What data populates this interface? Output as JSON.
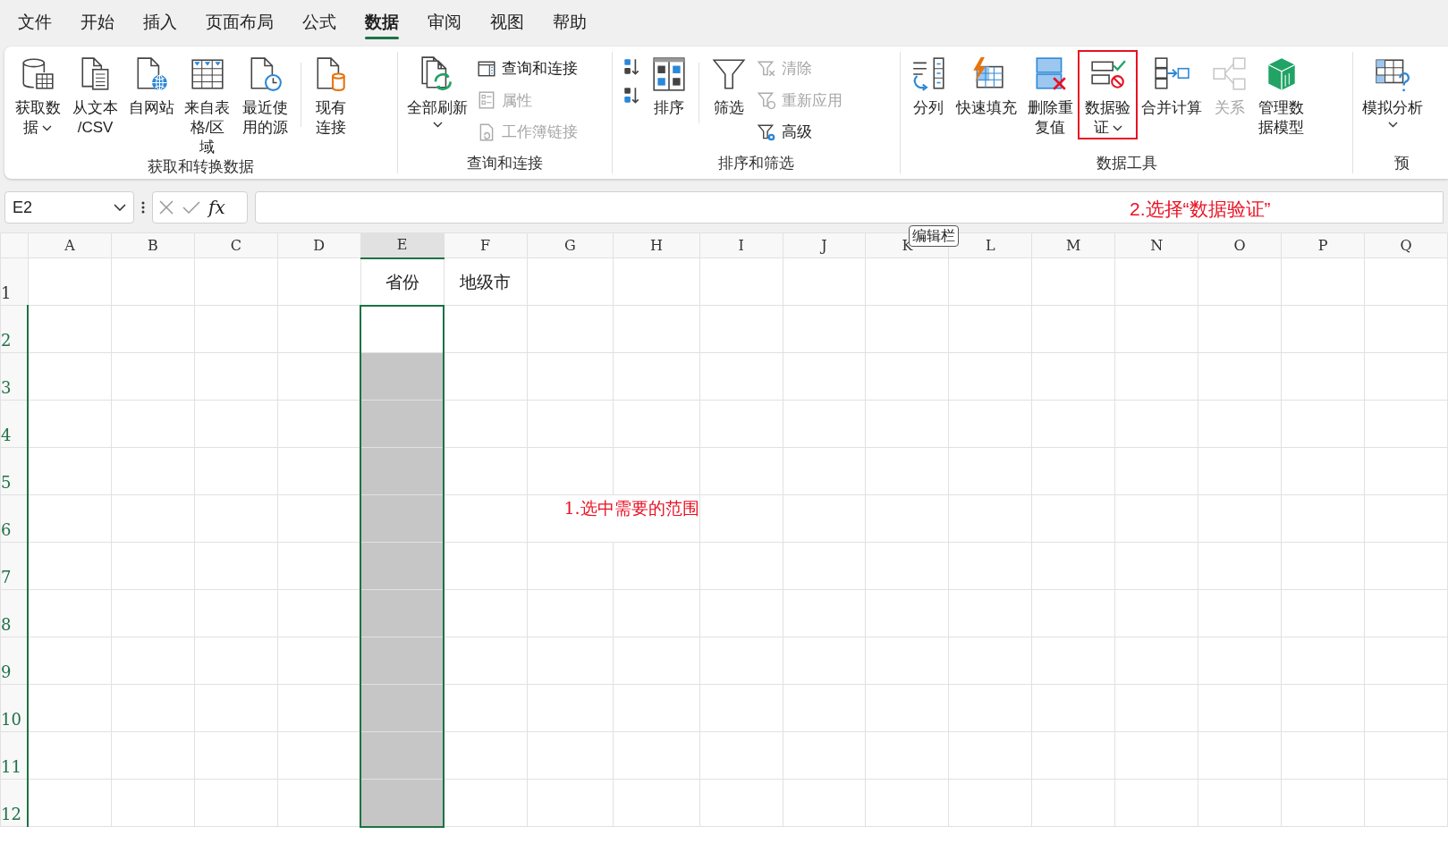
{
  "menu_tabs": [
    {
      "label": "文件",
      "selected": false
    },
    {
      "label": "开始",
      "selected": false
    },
    {
      "label": "插入",
      "selected": false
    },
    {
      "label": "页面布局",
      "selected": false
    },
    {
      "label": "公式",
      "selected": false
    },
    {
      "label": "数据",
      "selected": true
    },
    {
      "label": "审阅",
      "selected": false
    },
    {
      "label": "视图",
      "selected": false
    },
    {
      "label": "帮助",
      "selected": false
    }
  ],
  "ribbon_groups": [
    {
      "label": "获取和转换数据",
      "items": [
        {
          "kind": "large",
          "label": "获取数据",
          "dropdown": true,
          "disabled": false,
          "highlighted": false
        },
        {
          "kind": "large",
          "label": "从文本/CSV",
          "dropdown": false,
          "disabled": false,
          "highlighted": false
        },
        {
          "kind": "large",
          "label": "自网站",
          "dropdown": false,
          "disabled": false,
          "highlighted": false
        },
        {
          "kind": "large",
          "label": "来自表格/区域",
          "dropdown": false,
          "disabled": false,
          "highlighted": false
        },
        {
          "kind": "large",
          "label": "最近使用的源",
          "dropdown": false,
          "disabled": false,
          "highlighted": false
        },
        {
          "kind": "separator"
        },
        {
          "kind": "large",
          "label": "现有连接",
          "dropdown": false,
          "disabled": false,
          "highlighted": false
        }
      ]
    },
    {
      "label": "查询和连接",
      "items": [
        {
          "kind": "large",
          "label": "全部刷新",
          "dropdown": true,
          "disabled": false,
          "highlighted": false
        },
        {
          "kind": "stack",
          "items": [
            {
              "label": "查询和连接",
              "disabled": false
            },
            {
              "label": "属性",
              "disabled": true
            },
            {
              "label": "工作簿链接",
              "disabled": true
            }
          ]
        }
      ]
    },
    {
      "label": "排序和筛选",
      "items": [
        {
          "kind": "stack",
          "items": [
            {
              "disabled": false
            },
            {
              "disabled": false
            }
          ]
        },
        {
          "kind": "large",
          "label": "排序",
          "dropdown": false,
          "disabled": false,
          "highlighted": false
        },
        {
          "kind": "separator"
        },
        {
          "kind": "large",
          "label": "筛选",
          "dropdown": false,
          "disabled": false,
          "highlighted": false
        },
        {
          "kind": "stack",
          "items": [
            {
              "label": "清除",
              "disabled": true
            },
            {
              "label": "重新应用",
              "disabled": true
            },
            {
              "label": "高级",
              "disabled": false
            }
          ]
        }
      ]
    },
    {
      "label": "数据工具",
      "items": [
        {
          "kind": "large",
          "label": "分列",
          "dropdown": false,
          "disabled": false,
          "highlighted": false
        },
        {
          "kind": "large",
          "label": "快速填充",
          "dropdown": false,
          "disabled": false,
          "highlighted": false
        },
        {
          "kind": "large",
          "label": "删除重复值",
          "dropdown": false,
          "disabled": false,
          "highlighted": false
        },
        {
          "kind": "large",
          "label": "数据验证",
          "dropdown": true,
          "disabled": false,
          "highlighted": true
        },
        {
          "kind": "large",
          "label": "合并计算",
          "dropdown": false,
          "disabled": false,
          "highlighted": false
        },
        {
          "kind": "large",
          "label": "关系",
          "dropdown": false,
          "disabled": true,
          "highlighted": false
        },
        {
          "kind": "large",
          "label": "管理数据模型",
          "dropdown": false,
          "disabled": false,
          "highlighted": false
        }
      ]
    },
    {
      "label": "预",
      "items": [
        {
          "kind": "large",
          "label": "模拟分析",
          "dropdown": true,
          "disabled": false,
          "highlighted": false
        }
      ]
    }
  ],
  "name_box": {
    "value": "E2"
  },
  "formula_bar": {
    "function_label": "fx",
    "annotation": "2.选择“数据验证”"
  },
  "tooltip": {
    "text": "编辑栏"
  },
  "sheet": {
    "columns": [
      {
        "label": "A",
        "selected": false
      },
      {
        "label": "B",
        "selected": false
      },
      {
        "label": "C",
        "selected": false
      },
      {
        "label": "D",
        "selected": false
      },
      {
        "label": "E",
        "selected": true
      },
      {
        "label": "F",
        "selected": false
      },
      {
        "label": "G",
        "selected": false
      },
      {
        "label": "H",
        "selected": false
      },
      {
        "label": "I",
        "selected": false
      },
      {
        "label": "J",
        "selected": false
      },
      {
        "label": "K",
        "selected": false
      },
      {
        "label": "L",
        "selected": false
      },
      {
        "label": "M",
        "selected": false
      },
      {
        "label": "N",
        "selected": false
      },
      {
        "label": "O",
        "selected": false
      },
      {
        "label": "P",
        "selected": false
      },
      {
        "label": "Q",
        "selected": false
      }
    ],
    "rows": [
      {
        "number": "1",
        "selected": false,
        "active": false,
        "cells": [
          {},
          {},
          {},
          {},
          {
            "text": "省份"
          },
          {
            "text": "地级市"
          }
        ]
      },
      {
        "number": "2",
        "selected": true,
        "active": true
      },
      {
        "number": "3",
        "selected": true,
        "active": false
      },
      {
        "number": "4",
        "selected": true,
        "active": false
      },
      {
        "number": "5",
        "selected": true,
        "active": false
      },
      {
        "number": "6",
        "selected": true,
        "active": false
      },
      {
        "number": "7",
        "selected": true,
        "active": false
      },
      {
        "number": "8",
        "selected": true,
        "active": false
      },
      {
        "number": "9",
        "selected": true,
        "active": false
      },
      {
        "number": "10",
        "selected": true,
        "active": false
      },
      {
        "number": "11",
        "selected": true,
        "active": false
      },
      {
        "number": "12",
        "selected": true,
        "active": false
      }
    ],
    "annotation": "1.选中需要的范围"
  }
}
